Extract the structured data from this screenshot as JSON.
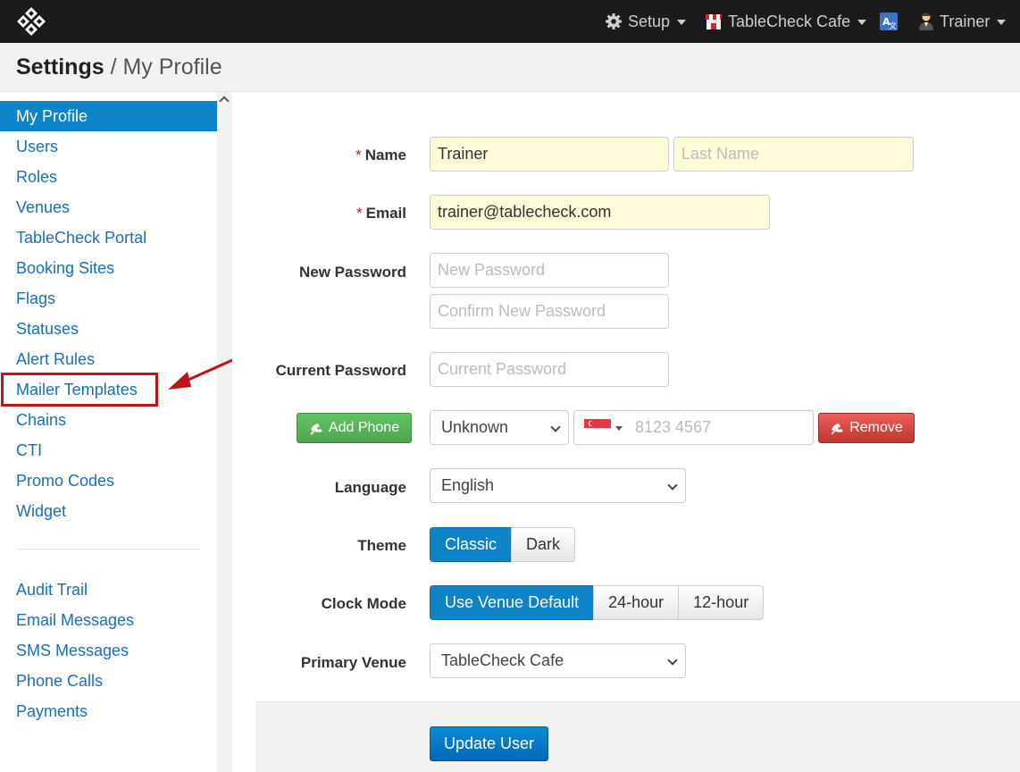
{
  "navbar": {
    "setup_label": "Setup",
    "venue_label": "TableCheck Cafe",
    "user_label": "Trainer"
  },
  "header": {
    "title": "Settings",
    "separator": "/",
    "subtitle": "My Profile"
  },
  "sidebar": {
    "items": [
      {
        "label": "My Profile"
      },
      {
        "label": "Users"
      },
      {
        "label": "Roles"
      },
      {
        "label": "Venues"
      },
      {
        "label": "TableCheck Portal"
      },
      {
        "label": "Booking Sites"
      },
      {
        "label": "Flags"
      },
      {
        "label": "Statuses"
      },
      {
        "label": "Alert Rules"
      },
      {
        "label": "Mailer Templates"
      },
      {
        "label": "Chains"
      },
      {
        "label": "CTI"
      },
      {
        "label": "Promo Codes"
      },
      {
        "label": "Widget"
      }
    ],
    "secondary_items": [
      {
        "label": "Audit Trail"
      },
      {
        "label": "Email Messages"
      },
      {
        "label": "SMS Messages"
      },
      {
        "label": "Phone Calls"
      },
      {
        "label": "Payments"
      }
    ]
  },
  "form": {
    "name_label": "Name",
    "first_name_value": "Trainer",
    "last_name_placeholder": "Last Name",
    "email_label": "Email",
    "email_value": "trainer@tablecheck.com",
    "new_password_label": "New Password",
    "new_password_placeholder": "New Password",
    "confirm_password_placeholder": "Confirm New Password",
    "current_password_label": "Current Password",
    "current_password_placeholder": "Current Password",
    "add_phone_label": "Add Phone",
    "phone_type_value": "Unknown",
    "phone_placeholder": "8123 4567",
    "remove_label": "Remove",
    "language_label": "Language",
    "language_value": "English",
    "theme_label": "Theme",
    "theme_options": [
      "Classic",
      "Dark"
    ],
    "clock_mode_label": "Clock Mode",
    "clock_options": [
      "Use Venue Default",
      "24-hour",
      "12-hour"
    ],
    "primary_venue_label": "Primary Venue",
    "primary_venue_value": "TableCheck Cafe",
    "submit_label": "Update User"
  },
  "colors": {
    "active": "#0f83c8",
    "link": "#1a6fb4",
    "highlight": "#c0141b"
  }
}
